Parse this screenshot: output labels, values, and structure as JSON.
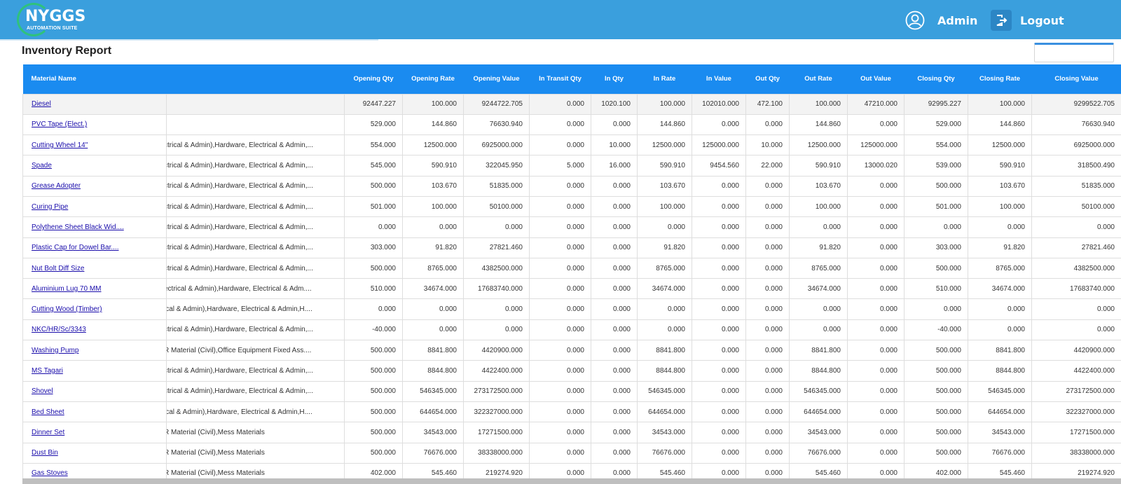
{
  "app": {
    "logo_text": "NYGGS",
    "logo_sub": "AUTOMATION SUITE",
    "user_label": "Admin",
    "logout_label": "Logout"
  },
  "page": {
    "title": "Inventory Report"
  },
  "table": {
    "columns": [
      "Material Name",
      "",
      "Opening Qty",
      "Opening Rate",
      "Opening Value",
      "In Transit Qty",
      "In Qty",
      "In Rate",
      "In Value",
      "Out Qty",
      "Out Rate",
      "Out Value",
      "Closing Qty",
      "Closing Rate",
      "Closing Value"
    ],
    "rows": [
      [
        "Diesel",
        "",
        "92447.227",
        "100.000",
        "9244722.705",
        "0.000",
        "1020.100",
        "100.000",
        "102010.000",
        "472.100",
        "100.000",
        "47210.000",
        "92995.227",
        "100.000",
        "9299522.705"
      ],
      [
        "PVC Tape (Elect.)",
        "",
        "529.000",
        "144.860",
        "76630.940",
        "0.000",
        "0.000",
        "144.860",
        "0.000",
        "0.000",
        "144.860",
        "0.000",
        "529.000",
        "144.860",
        "76630.940"
      ],
      [
        "Cutting Wheel 14\"",
        "ctrical & Admin),Hardware, Electrical & Admin,...",
        "554.000",
        "12500.000",
        "6925000.000",
        "0.000",
        "10.000",
        "12500.000",
        "125000.000",
        "10.000",
        "12500.000",
        "125000.000",
        "554.000",
        "12500.000",
        "6925000.000"
      ],
      [
        "Spade",
        "ctrical & Admin),Hardware, Electrical & Admin,...",
        "545.000",
        "590.910",
        "322045.950",
        "5.000",
        "16.000",
        "590.910",
        "9454.560",
        "22.000",
        "590.910",
        "13000.020",
        "539.000",
        "590.910",
        "318500.490"
      ],
      [
        "Grease Adopter",
        "ctrical & Admin),Hardware, Electrical & Admin,...",
        "500.000",
        "103.670",
        "51835.000",
        "0.000",
        "0.000",
        "103.670",
        "0.000",
        "0.000",
        "103.670",
        "0.000",
        "500.000",
        "103.670",
        "51835.000"
      ],
      [
        "Curing Pipe",
        "ctrical & Admin),Hardware, Electrical & Admin,...",
        "501.000",
        "100.000",
        "50100.000",
        "0.000",
        "0.000",
        "100.000",
        "0.000",
        "0.000",
        "100.000",
        "0.000",
        "501.000",
        "100.000",
        "50100.000"
      ],
      [
        "Polythene Sheet Black Wid....",
        "ctrical & Admin),Hardware, Electrical & Admin,...",
        "0.000",
        "0.000",
        "0.000",
        "0.000",
        "0.000",
        "0.000",
        "0.000",
        "0.000",
        "0.000",
        "0.000",
        "0.000",
        "0.000",
        "0.000"
      ],
      [
        "Plastic Cap for Dowel Bar....",
        "ctrical & Admin),Hardware, Electrical & Admin,...",
        "303.000",
        "91.820",
        "27821.460",
        "0.000",
        "0.000",
        "91.820",
        "0.000",
        "0.000",
        "91.820",
        "0.000",
        "303.000",
        "91.820",
        "27821.460"
      ],
      [
        "Nut Bolt Diff Size",
        "ctrical & Admin),Hardware, Electrical & Admin,...",
        "500.000",
        "8765.000",
        "4382500.000",
        "0.000",
        "0.000",
        "8765.000",
        "0.000",
        "0.000",
        "8765.000",
        "0.000",
        "500.000",
        "8765.000",
        "4382500.000"
      ],
      [
        "Aluminium Lug 70 MM",
        "ectrical & Admin),Hardware, Electrical & Adm....",
        "510.000",
        "34674.000",
        "17683740.000",
        "0.000",
        "0.000",
        "34674.000",
        "0.000",
        "0.000",
        "34674.000",
        "0.000",
        "510.000",
        "34674.000",
        "17683740.000"
      ],
      [
        "Cutting Wood (Timber)",
        "ical & Admin),Hardware, Electrical & Admin,H....",
        "0.000",
        "0.000",
        "0.000",
        "0.000",
        "0.000",
        "0.000",
        "0.000",
        "0.000",
        "0.000",
        "0.000",
        "0.000",
        "0.000",
        "0.000"
      ],
      [
        "NKC/HR/Sc/3343",
        "ctrical & Admin),Hardware, Electrical & Admin,...",
        "-40.000",
        "0.000",
        "0.000",
        "0.000",
        "0.000",
        "0.000",
        "0.000",
        "0.000",
        "0.000",
        "0.000",
        "-40.000",
        "0.000",
        "0.000"
      ],
      [
        "Washing Pump",
        "R Material (Civil),Office Equipment Fixed Ass....",
        "500.000",
        "8841.800",
        "4420900.000",
        "0.000",
        "0.000",
        "8841.800",
        "0.000",
        "0.000",
        "8841.800",
        "0.000",
        "500.000",
        "8841.800",
        "4420900.000"
      ],
      [
        "MS Tagari",
        "ctrical & Admin),Hardware, Electrical & Admin,...",
        "500.000",
        "8844.800",
        "4422400.000",
        "0.000",
        "0.000",
        "8844.800",
        "0.000",
        "0.000",
        "8844.800",
        "0.000",
        "500.000",
        "8844.800",
        "4422400.000"
      ],
      [
        "Shovel",
        "ctrical & Admin),Hardware, Electrical & Admin,...",
        "500.000",
        "546345.000",
        "273172500.000",
        "0.000",
        "0.000",
        "546345.000",
        "0.000",
        "0.000",
        "546345.000",
        "0.000",
        "500.000",
        "546345.000",
        "273172500.000"
      ],
      [
        "Bed Sheet",
        "ical & Admin),Hardware, Electrical & Admin,H....",
        "500.000",
        "644654.000",
        "322327000.000",
        "0.000",
        "0.000",
        "644654.000",
        "0.000",
        "0.000",
        "644654.000",
        "0.000",
        "500.000",
        "644654.000",
        "322327000.000"
      ],
      [
        "Dinner Set",
        "R Material (Civil),Mess Materials",
        "500.000",
        "34543.000",
        "17271500.000",
        "0.000",
        "0.000",
        "34543.000",
        "0.000",
        "0.000",
        "34543.000",
        "0.000",
        "500.000",
        "34543.000",
        "17271500.000"
      ],
      [
        "Dust Bin",
        "R Material (Civil),Mess Materials",
        "500.000",
        "76676.000",
        "38338000.000",
        "0.000",
        "0.000",
        "76676.000",
        "0.000",
        "0.000",
        "76676.000",
        "0.000",
        "500.000",
        "76676.000",
        "38338000.000"
      ],
      [
        "Gas Stoves",
        "R Material (Civil),Mess Materials",
        "402.000",
        "545.460",
        "219274.920",
        "0.000",
        "0.000",
        "545.460",
        "0.000",
        "0.000",
        "545.460",
        "0.000",
        "402.000",
        "545.460",
        "219274.920"
      ]
    ]
  }
}
